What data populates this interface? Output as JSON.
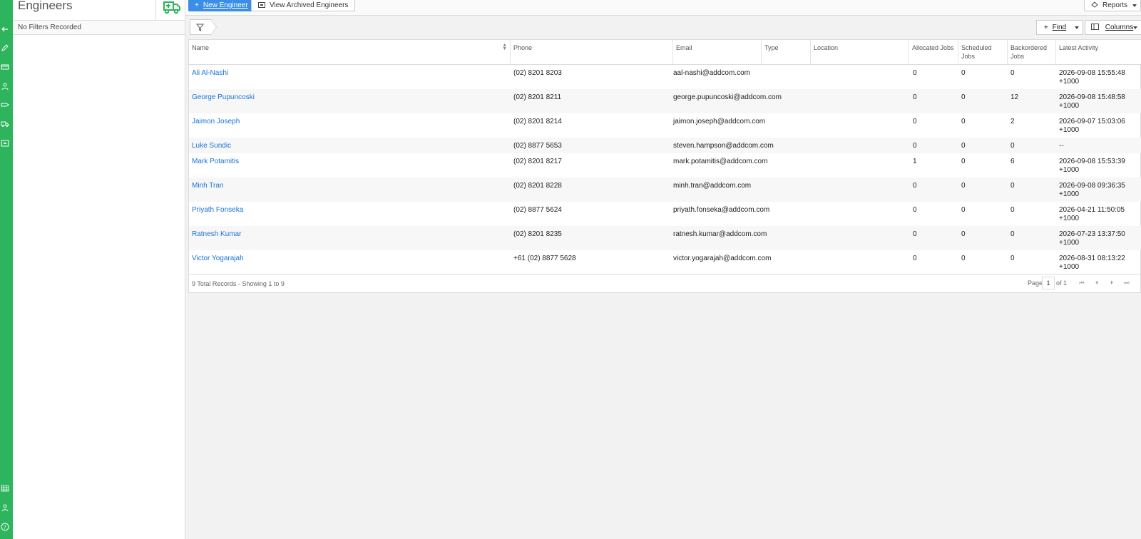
{
  "sidebar": {
    "title": "Engineers",
    "filters_text": "No Filters Recorded"
  },
  "toolbar": {
    "new_label": "New Engineer",
    "archived_label": "View Archived Engineers",
    "reports_label": "Reports"
  },
  "filter_bar": {
    "find_label": "Find",
    "columns_label": "Columns"
  },
  "table": {
    "columns": [
      "Name",
      "Phone",
      "Email",
      "Type",
      "Location",
      "Allocated Jobs",
      "Scheduled Jobs",
      "Backordered Jobs",
      "Latest Activity"
    ],
    "rows": [
      {
        "name": "Ali Al-Nashi",
        "phone": "(02) 8201 8203",
        "email": "aal-nashi@addcom.com",
        "type": "",
        "location": "",
        "allocated": "0",
        "scheduled": "0",
        "backordered": "0",
        "activity_1": "2026-09-08 15:55:48",
        "activity_2": "+1000"
      },
      {
        "name": "George Pupuncoski",
        "phone": "(02) 8201 8211",
        "email": "george.pupuncoski@addcom.com",
        "type": "",
        "location": "",
        "allocated": "0",
        "scheduled": "0",
        "backordered": "12",
        "activity_1": "2026-09-08 15:48:58",
        "activity_2": "+1000"
      },
      {
        "name": "Jaimon Joseph",
        "phone": "(02) 8201 8214",
        "email": "jaimon.joseph@addcom.com",
        "type": "",
        "location": "",
        "allocated": "0",
        "scheduled": "0",
        "backordered": "2",
        "activity_1": "2026-09-07 15:03:06",
        "activity_2": "+1000"
      },
      {
        "name": "Luke Sundic",
        "phone": "(02) 8877 5653",
        "email": "steven.hampson@addcom.com",
        "type": "",
        "location": "",
        "allocated": "0",
        "scheduled": "0",
        "backordered": "0",
        "activity_1": "--",
        "activity_2": ""
      },
      {
        "name": "Mark Potamitis",
        "phone": "(02) 8201 8217",
        "email": "mark.potamitis@addcom.com",
        "type": "",
        "location": "",
        "allocated": "1",
        "scheduled": "0",
        "backordered": "6",
        "activity_1": "2026-09-08 15:53:39",
        "activity_2": "+1000"
      },
      {
        "name": "Minh Tran",
        "phone": "(02) 8201 8228",
        "email": "minh.tran@addcom.com",
        "type": "",
        "location": "",
        "allocated": "0",
        "scheduled": "0",
        "backordered": "0",
        "activity_1": "2026-09-08 09:36:35",
        "activity_2": "+1000"
      },
      {
        "name": "Priyath Fonseka",
        "phone": "(02) 8877 5624",
        "email": "priyath.fonseka@addcom.com",
        "type": "",
        "location": "",
        "allocated": "0",
        "scheduled": "0",
        "backordered": "0",
        "activity_1": "2026-04-21 11:50:05",
        "activity_2": "+1000"
      },
      {
        "name": "Ratnesh Kumar",
        "phone": "(02) 8201 8235",
        "email": "ratnesh.kumar@addcom.com",
        "type": "",
        "location": "",
        "allocated": "0",
        "scheduled": "0",
        "backordered": "0",
        "activity_1": "2026-07-23 13:37:50",
        "activity_2": "+1000"
      },
      {
        "name": "Victor Yogarajah",
        "phone": "+61 (02) 8877 5628",
        "email": "victor.yogarajah@addcom.com",
        "type": "",
        "location": "",
        "allocated": "0",
        "scheduled": "0",
        "backordered": "0",
        "activity_1": "2026-08-31 08:13:22",
        "activity_2": "+1000"
      }
    ],
    "footer": {
      "total_text": "9 Total Records - Showing 1 to 9",
      "page_label": "Page",
      "page_value": "1",
      "of_label": "of 1"
    }
  },
  "colors": {
    "rail": "#2db45c",
    "primary": "#3b8ee8",
    "link": "#1a73d9"
  }
}
